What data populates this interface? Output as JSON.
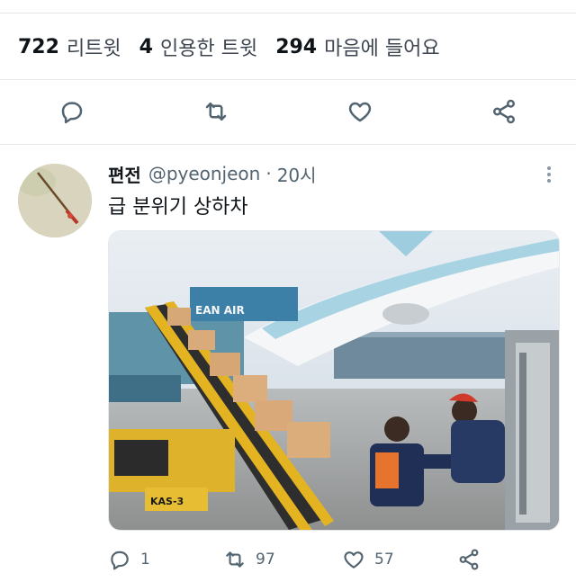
{
  "stats": {
    "retweets": {
      "count": "722",
      "label": "리트윗"
    },
    "quotes": {
      "count": "4",
      "label": "인용한 트윗"
    },
    "likes": {
      "count": "294",
      "label": "마음에 들어요"
    }
  },
  "action_icons": [
    "reply-icon",
    "retweet-icon",
    "like-icon",
    "share-icon"
  ],
  "reply_tweet": {
    "name": "편전",
    "handle": "@pyeonjeon",
    "separator": "·",
    "time": "20시",
    "text": "급 분위기 상하차",
    "image_text": "KAS-3",
    "aircraft_text": "EAN AIR",
    "counts": {
      "reply": "1",
      "retweet": "97",
      "like": "57"
    }
  },
  "colors": {
    "text": "#0f1419",
    "secondary": "#536471",
    "divider": "#e6e8eb"
  }
}
